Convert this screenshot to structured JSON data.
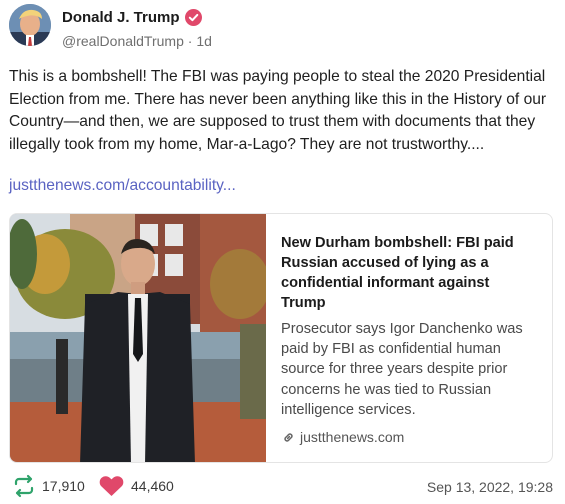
{
  "post": {
    "author_name": "Donald J. Trump",
    "handle": "@realDonaldTrump",
    "separator": "·",
    "age": "1d",
    "text": "This is a bombshell! The FBI was paying people to steal the 2020 Presidential Election from me. There has never been anything like this in the History of our Country—and then, we are supposed to trust them with documents that they illegally took from my home, Mar-a-Lago? They are not trustworthy....",
    "link_text": "justthenews.com/accountability...",
    "link_color": "#5a63c2",
    "verified_color": "#e0486a"
  },
  "card": {
    "title": "New Durham bombshell: FBI paid Russian accused of lying as a confidential informant against Trump",
    "description": "Prosecutor says Igor Danchenko was paid by FBI as confidential human source for three years despite prior concerns he was tied to Russian intelligence services.",
    "source": "justthenews.com",
    "source_icon": "link-icon"
  },
  "footer": {
    "retruths_icon": "retruth-icon",
    "retruths": "17,910",
    "likes_icon": "heart-icon",
    "likes": "44,460",
    "timestamp": "Sep 13, 2022, 19:28",
    "retruth_color": "#2fa36b",
    "like_color": "#e0486a"
  }
}
